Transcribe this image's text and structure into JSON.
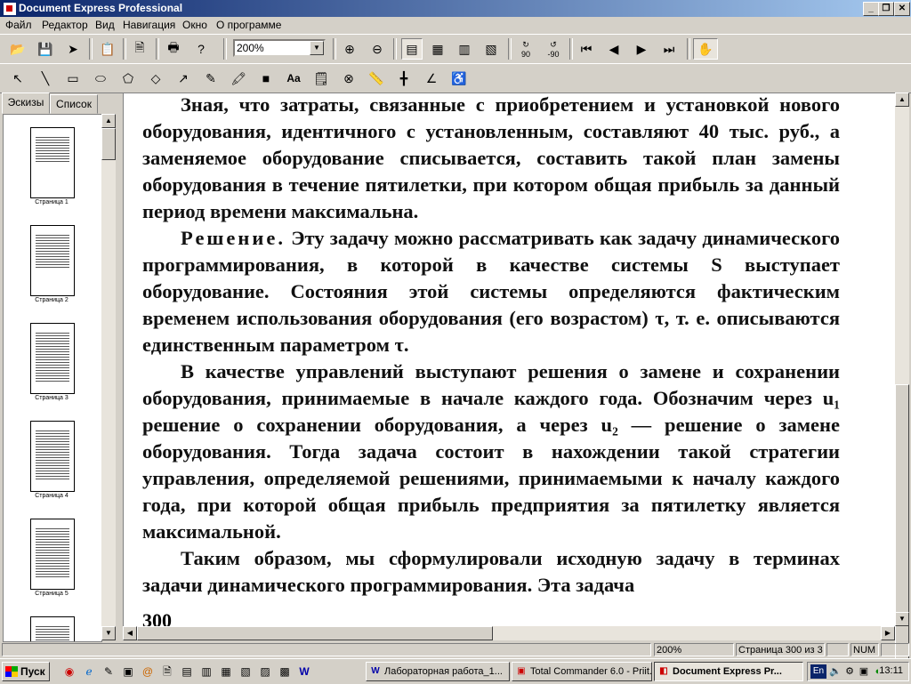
{
  "window": {
    "title": "Document Express Professional"
  },
  "menu": [
    "Файл",
    "Редактор",
    "Вид",
    "Навигация",
    "Окно",
    "О программе"
  ],
  "toolbar": {
    "zoom_value": "200%",
    "rotate_cw_label": "90",
    "rotate_ccw_label": "-90",
    "text_tool_label": "Aa"
  },
  "sidebar": {
    "tabs": [
      "Эскизы",
      "Список"
    ],
    "thumbnails": [
      "Страница 1",
      "Страница 2",
      "Страница 3",
      "Страница 4",
      "Страница 5"
    ]
  },
  "document": {
    "paragraphs": [
      "Зная, что затраты, связанные с приобретением и установкой нового оборудования, идентичного с установленным, составляют 40 тыс. руб., а заменяемое оборудование списывается, составить такой план замены оборудования в течение пятилетки, при котором общая прибыль за данный период времени максимальна."
    ],
    "p2_head": "Решение.",
    "p2_body": " Эту задачу можно рассматривать как задачу динамического программирования, в которой в качестве системы S выступает оборудование. Состояния этой системы определяются фактическим временем использования оборудования (его возрастом) τ, т. е. описываются единственным параметром τ.",
    "p3": "В качестве управлений выступают решения о замене и сохранении оборудования, принимаемые в начале каждого года. Обозначим через u₁ решение о сохранении оборудования, а через u₂ — решение о замене оборудования. Тогда задача состоит в нахождении такой стратегии управления, определяемой решениями, принимаемыми к началу каждого года, при которой общая прибыль предприятия за пятилетку является максимальной.",
    "p4": "Таким образом, мы сформулировали исходную задачу в терминах задачи динамического программирования. Эта задача",
    "page_number": "300"
  },
  "status": {
    "zoom": "200%",
    "page": "Страница 300 из 3",
    "num": "NUM"
  },
  "taskbar": {
    "start": "Пуск",
    "tasks": [
      "Лабораторная работа_1...",
      "Total Commander 6.0 - Priit...",
      "Document Express Pr..."
    ],
    "lang": "En",
    "clock": "13:11"
  }
}
